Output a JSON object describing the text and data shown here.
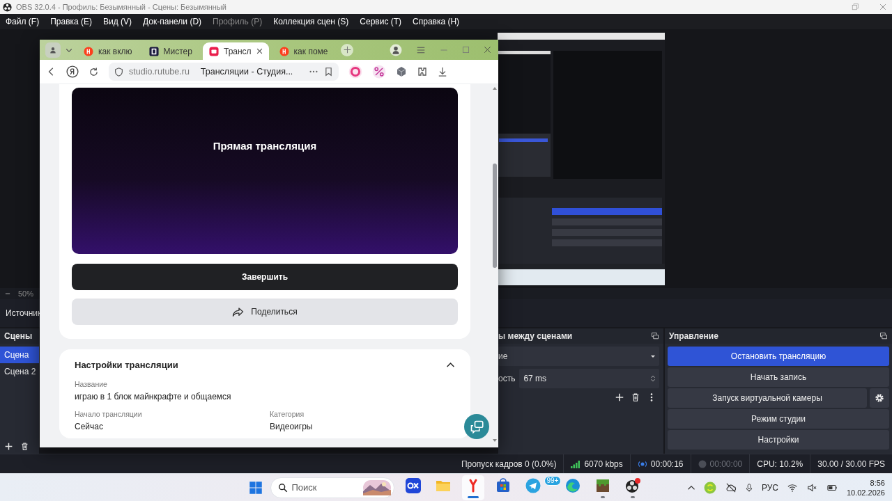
{
  "obs": {
    "title": "OBS 32.0.4 - Профиль: Безымянный - Сцены: Безымянный",
    "menu": [
      {
        "label": "Файл (F)",
        "disabled": false
      },
      {
        "label": "Правка (E)",
        "disabled": false
      },
      {
        "label": "Вид (V)",
        "disabled": false
      },
      {
        "label": "Док-панели (D)",
        "disabled": false
      },
      {
        "label": "Профиль (P)",
        "disabled": true
      },
      {
        "label": "Коллекция сцен (S)",
        "disabled": false
      },
      {
        "label": "Сервис (T)",
        "disabled": false
      },
      {
        "label": "Справка (H)",
        "disabled": false
      }
    ],
    "preview": {
      "kind": "picture",
      "zoom": "50%"
    },
    "sources_title": "Источник",
    "scenes": {
      "title": "Сцены",
      "items": [
        {
          "label": "Сцена",
          "selected": true
        },
        {
          "label": "Сцена 2",
          "selected": false
        }
      ]
    },
    "transitions": {
      "title": "ы между сценами",
      "transition": "ие",
      "duration_label": "ость",
      "duration": "67 ms"
    },
    "controls": {
      "title": "Управление",
      "buttons": [
        {
          "label": "Остановить трансляцию",
          "kind": "plain",
          "active": true
        },
        {
          "label": "Начать запись",
          "kind": "plain",
          "active": false
        },
        {
          "label": "Запуск виртуальной камеры",
          "kind": "with_settings",
          "active": false
        },
        {
          "label": "Режим студии",
          "kind": "plain",
          "active": false
        },
        {
          "label": "Настройки",
          "kind": "plain",
          "active": false
        }
      ]
    },
    "status_bar": {
      "dropped": "Пропуск кадров 0 (0.0%)",
      "bitrate": "6070 kbps",
      "streaming": true,
      "stream_time": "00:00:16",
      "recording": false,
      "record_time": "00:00:00",
      "cpu": "CPU: 10.2%",
      "fps": "30.00 / 30.00 FPS"
    }
  },
  "browser": {
    "tabs": [
      {
        "label": "как вклю",
        "kind": "search",
        "selected": false
      },
      {
        "label": "Мистер",
        "kind": "r",
        "selected": false
      },
      {
        "label": "Трансл",
        "kind": "s",
        "selected": true
      },
      {
        "label": "как поме",
        "kind": "search",
        "selected": false
      }
    ],
    "address": {
      "domain": "studio.rutube.ru",
      "page_title": "Трансляции - Студия..."
    },
    "page": {
      "player_caption": "Прямая трансляция",
      "finish": "Завершить",
      "share": "Поделиться",
      "settings": {
        "title": "Настройки трансляции",
        "expanded": true,
        "fields": [
          {
            "label": "Название",
            "value": "играю в 1 блок майнкрафте и общаемся"
          },
          {
            "label": "Начало трансляции",
            "value": "Сейчас"
          },
          {
            "label": "Категория",
            "value": "Видеоигры"
          }
        ]
      }
    }
  },
  "taskbar": {
    "search_placeholder": "Поиск",
    "apps": [
      {
        "kind": "xo",
        "active": false,
        "running": false
      },
      {
        "kind": "folder",
        "active": false,
        "running": false
      },
      {
        "kind": "browser",
        "active": true,
        "running": true
      },
      {
        "kind": "store",
        "active": false,
        "running": false
      },
      {
        "kind": "telegram",
        "active": false,
        "running": false,
        "badge": "99+"
      },
      {
        "kind": "edge",
        "active": false,
        "running": false
      },
      {
        "kind": "blocks",
        "active": false,
        "running": true
      },
      {
        "kind": "obs",
        "active": false,
        "running": true
      }
    ],
    "language": "РУС",
    "time": "8:56",
    "date": "10.02.2026"
  }
}
